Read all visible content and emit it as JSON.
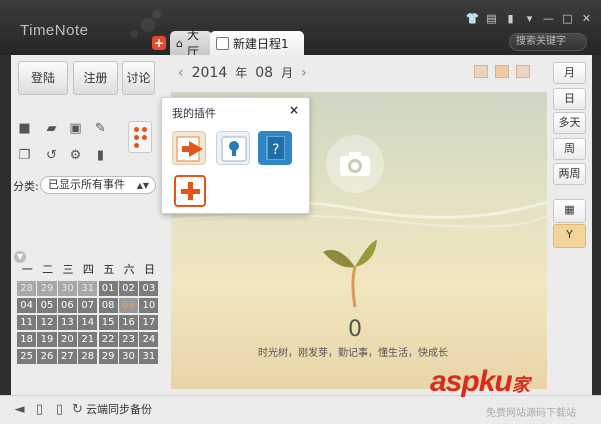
{
  "app": {
    "title": "TimeNote",
    "search_placeholder": "搜索关键字"
  },
  "tabs": [
    {
      "label": "大厅"
    },
    {
      "label": "新建日程1"
    }
  ],
  "account": {
    "login": "登陆",
    "register": "注册",
    "discuss": "讨论"
  },
  "filter": {
    "label": "分类:",
    "value": "已显示所有事件"
  },
  "calendar": {
    "year": "2014",
    "year_unit": "年",
    "month": "08",
    "month_unit": "月",
    "weekdays": [
      "一",
      "二",
      "三",
      "四",
      "五",
      "六",
      "日"
    ],
    "days": [
      "28",
      "29",
      "30",
      "31",
      "01",
      "02",
      "03",
      "04",
      "05",
      "06",
      "07",
      "08",
      "09",
      "10",
      "11",
      "12",
      "13",
      "14",
      "15",
      "16",
      "17",
      "18",
      "19",
      "20",
      "21",
      "22",
      "23",
      "24",
      "25",
      "26",
      "27",
      "28",
      "29",
      "30",
      "31"
    ]
  },
  "plugins": {
    "title": "我的插件",
    "close": "×"
  },
  "main": {
    "count": "0",
    "slogan": "时光树，刚发芽，勤记事，懂生活，快成长"
  },
  "views": {
    "month": "月",
    "day": "日",
    "multi": "多天",
    "week": "周",
    "two_week": "两周"
  },
  "status": {
    "sync": "云端同步备份"
  },
  "watermark": {
    "brand": "aspku",
    "suffix": "家",
    "sub": "免费网站源码下载站"
  },
  "colors": {
    "accent": "#e2561c",
    "titlebar": "#2b2b2b",
    "cell": "#7b7b7b"
  }
}
